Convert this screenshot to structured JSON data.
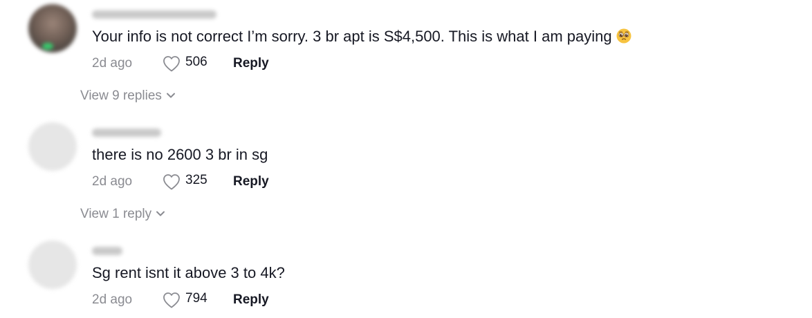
{
  "comments": [
    {
      "text": "Your info is not correct I’m sorry. 3 br apt is S$4,500. This is what I am paying",
      "emoji": "pleading-face-emoji",
      "time": "2d ago",
      "likes": "506",
      "reply_label": "Reply",
      "view_replies_label": "View 9 replies"
    },
    {
      "text": "there is no 2600 3 br in sg",
      "time": "2d ago",
      "likes": "325",
      "reply_label": "Reply",
      "view_replies_label": "View 1 reply"
    },
    {
      "text": "Sg rent isnt it above 3 to 4k?",
      "time": "2d ago",
      "likes": "794",
      "reply_label": "Reply"
    }
  ],
  "icons": {
    "like": "heart-outline-icon",
    "expand": "chevron-down-icon"
  },
  "colors": {
    "primary_text": "#161823",
    "secondary_text": "#8a8b91",
    "background": "#ffffff"
  }
}
